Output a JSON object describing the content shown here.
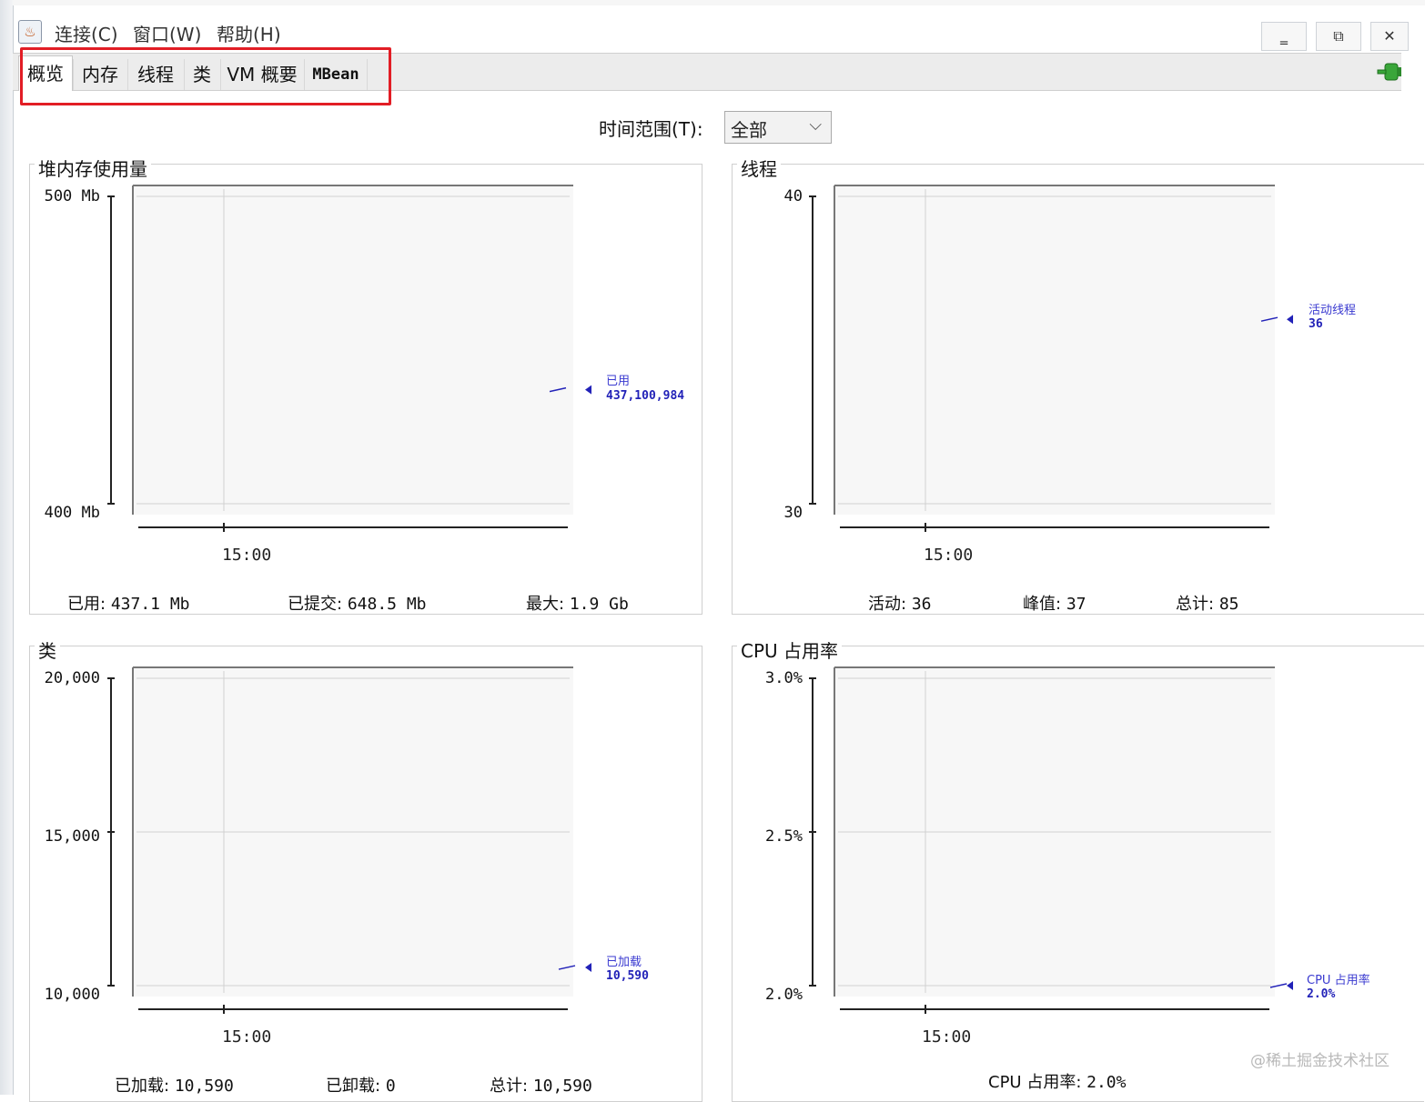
{
  "menus": [
    "连接(C)",
    "窗口(W)",
    "帮助(H)"
  ],
  "window_controls": {
    "minimize": "‗",
    "restore": "⧉",
    "close": "✕"
  },
  "tabs": [
    "概览",
    "内存",
    "线程",
    "类",
    "VM 概要",
    "MBean"
  ],
  "active_tab": "概览",
  "time_range": {
    "label": "时间范围(T):",
    "value": "全部"
  },
  "panels": {
    "heap": {
      "title": "堆内存使用量",
      "y_ticks": [
        "500 Mb",
        "400 Mb"
      ],
      "x_tick": "15:00",
      "legend_name": "已用",
      "legend_value": "437,100,984",
      "stats": [
        {
          "label": "已用:",
          "value": "437.1  Mb"
        },
        {
          "label": "已提交:",
          "value": "648.5  Mb"
        },
        {
          "label": "最大:",
          "value": "1.9  Gb"
        }
      ]
    },
    "threads": {
      "title": "线程",
      "y_ticks": [
        "40",
        "30"
      ],
      "x_tick": "15:00",
      "legend_name": "活动线程",
      "legend_value": "36",
      "stats": [
        {
          "label": "活动:",
          "value": "36"
        },
        {
          "label": "峰值:",
          "value": "37"
        },
        {
          "label": "总计:",
          "value": "85"
        }
      ]
    },
    "classes": {
      "title": "类",
      "y_ticks": [
        "20,000",
        "15,000",
        "10,000"
      ],
      "x_tick": "15:00",
      "legend_name": "已加载",
      "legend_value": "10,590",
      "stats": [
        {
          "label": "已加载:",
          "value": "10,590"
        },
        {
          "label": "已卸载:",
          "value": "0"
        },
        {
          "label": "总计:",
          "value": "10,590"
        }
      ]
    },
    "cpu": {
      "title": "CPU 占用率",
      "y_ticks": [
        "3.0%",
        "2.5%",
        "2.0%"
      ],
      "x_tick": "15:00",
      "legend_name": "CPU 占用率",
      "legend_value": "2.0%",
      "stats": [
        {
          "label": "CPU 占用率:",
          "value": "2.0%"
        }
      ]
    }
  },
  "watermark": "@稀土掘金技术社区",
  "colors": {
    "series": "#2222b8",
    "highlight": "#e21d25",
    "plot_bg": "#f7f7f7",
    "grid": "#d0d0d0"
  },
  "chart_data": [
    {
      "type": "line",
      "title": "堆内存使用量",
      "x": [
        "15:00"
      ],
      "ylim": [
        400,
        500
      ],
      "y_unit": "Mb",
      "series": [
        {
          "name": "已用",
          "values": [
            437.1
          ]
        }
      ]
    },
    {
      "type": "line",
      "title": "线程",
      "x": [
        "15:00"
      ],
      "ylim": [
        30,
        40
      ],
      "series": [
        {
          "name": "活动线程",
          "values": [
            36
          ]
        }
      ]
    },
    {
      "type": "line",
      "title": "类",
      "x": [
        "15:00"
      ],
      "ylim": [
        10000,
        20000
      ],
      "series": [
        {
          "name": "已加载",
          "values": [
            10590
          ]
        }
      ]
    },
    {
      "type": "line",
      "title": "CPU 占用率",
      "x": [
        "15:00"
      ],
      "ylim": [
        2.0,
        3.0
      ],
      "y_unit": "%",
      "series": [
        {
          "name": "CPU 占用率",
          "values": [
            2.0
          ]
        }
      ]
    }
  ]
}
